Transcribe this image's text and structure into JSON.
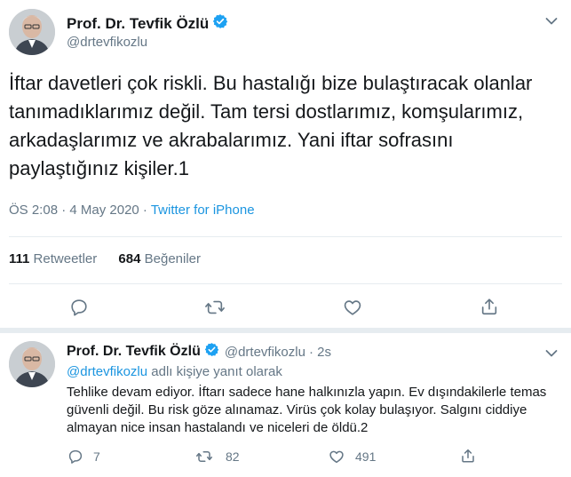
{
  "main_tweet": {
    "author_name": "Prof. Dr. Tevfik Özlü",
    "author_handle": "@drtevfikozlu",
    "text": "İftar davetleri çok riskli. Bu hastalığı bize bulaştıracak olanlar tanımadıklarımız değil. Tam tersi dostlarımız, komşularımız, arkadaşlarımız ve akrabalarımız. Yani iftar sofrasını paylaştığınız kişiler.1",
    "timestamp": "ÖS 2:08 · 4 May 2020",
    "source_separator": " · ",
    "source": "Twitter for iPhone",
    "retweet_count": "111",
    "retweet_label": "Retweetler",
    "like_count": "684",
    "like_label": "Beğeniler"
  },
  "reply_tweet": {
    "author_name": "Prof. Dr. Tevfik Özlü",
    "author_handle": "@drtevfikozlu",
    "time_ago": "· 2s",
    "reply_to_handle": "@drtevfikozlu",
    "reply_to_suffix": " adlı kişiye yanıt olarak",
    "text": "Tehlike devam ediyor. İftarı sadece hane halkınızla yapın. Ev dışındakilerle temas güvenli değil. Bu risk göze alınamaz. Virüs çok kolay bulaşıyor. Salgını ciddiye almayan nice insan hastalandı ve niceleri de öldü.2",
    "reply_count": "7",
    "retweet_count": "82",
    "like_count": "491"
  },
  "colors": {
    "accent": "#1b95e0",
    "verified": "#1da1f2",
    "secondary_text": "#657786",
    "divider": "#e6ecf0"
  },
  "icons": [
    "chevron-down-icon",
    "verified-badge-icon",
    "reply-icon",
    "retweet-icon",
    "like-icon",
    "share-icon"
  ]
}
